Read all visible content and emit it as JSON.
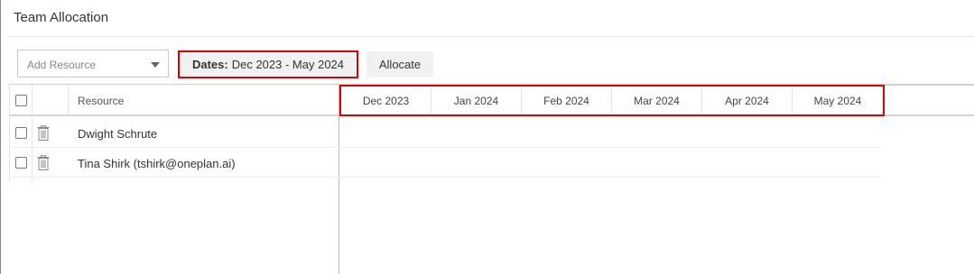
{
  "page": {
    "title": "Team Allocation"
  },
  "toolbar": {
    "add_resource_placeholder": "Add Resource",
    "dates_label": "Dates:",
    "dates_value": "Dec 2023 - May 2024",
    "allocate_label": "Allocate"
  },
  "grid": {
    "resource_header": "Resource",
    "months": [
      "Dec 2023",
      "Jan 2024",
      "Feb 2024",
      "Mar 2024",
      "Apr 2024",
      "May 2024"
    ],
    "rows": [
      {
        "name": "Dwight Schrute"
      },
      {
        "name": "Tina Shirk (tshirk@oneplan.ai)"
      }
    ]
  },
  "icons": {
    "trash": "trash-icon",
    "dropdown": "chevron-down-icon"
  },
  "colors": {
    "highlight": "#e00000",
    "button_bg": "#f1f1f1"
  }
}
